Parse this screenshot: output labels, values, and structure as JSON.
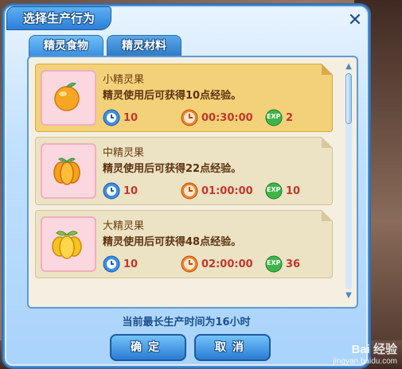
{
  "dialog": {
    "title": "选择生产行为",
    "close_symbol": "✕"
  },
  "tabs": [
    {
      "label": "精灵食物",
      "active": true
    },
    {
      "label": "精灵材料",
      "active": false
    }
  ],
  "items": [
    {
      "name": "小精灵果",
      "desc": "精灵使用后可获得10点经验。",
      "count": "10",
      "time": "00:30:00",
      "exp": "2",
      "selected": true
    },
    {
      "name": "中精灵果",
      "desc": "精灵使用后可获得22点经验。",
      "count": "10",
      "time": "01:00:00",
      "exp": "10",
      "selected": false
    },
    {
      "name": "大精灵果",
      "desc": "精灵使用后可获得48点经验。",
      "count": "10",
      "time": "02:00:00",
      "exp": "36",
      "selected": false
    }
  ],
  "footer": {
    "note": "当前最长生产时间为16小时",
    "confirm_label": "确定",
    "cancel_label": "取消"
  },
  "exp_badge": "EXP",
  "watermark": {
    "brand": "Bai 经验",
    "url": "jingyan.baidu.com"
  },
  "colors": {
    "accent": "#2c7fd6",
    "selected_item": "#f3d179",
    "item": "#ece2c4",
    "value_text": "#c0392b"
  }
}
